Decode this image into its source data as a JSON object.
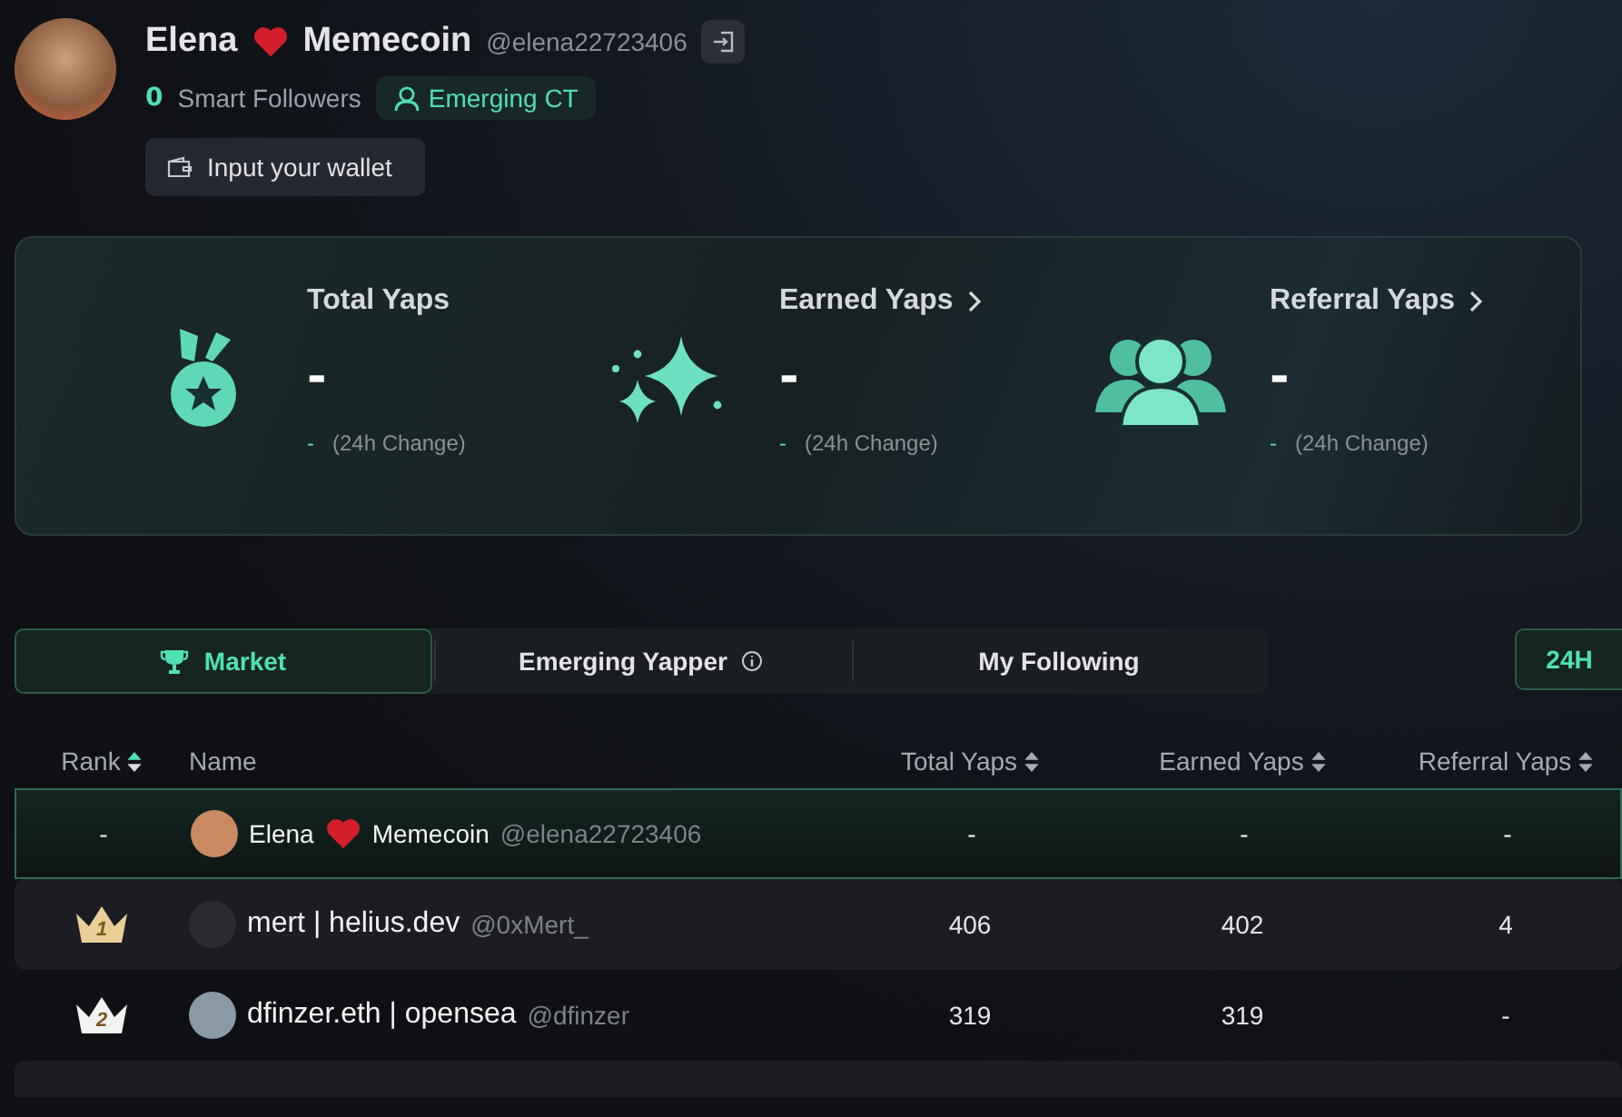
{
  "profile": {
    "name_parts": [
      "Elena",
      "Memecoin"
    ],
    "handle": "@elena22723406",
    "smart_followers_count": "0",
    "smart_followers_label": "Smart Followers",
    "badge": "Emerging CT",
    "wallet_button": "Input your wallet"
  },
  "stats": [
    {
      "kind": "medal",
      "title": "Total Yaps",
      "has_link": false,
      "value": "-",
      "change": "-",
      "change_label": "(24h Change)"
    },
    {
      "kind": "sparkles",
      "title": "Earned Yaps",
      "has_link": true,
      "value": "-",
      "change": "-",
      "change_label": "(24h Change)"
    },
    {
      "kind": "people",
      "title": "Referral Yaps",
      "has_link": true,
      "value": "-",
      "change": "-",
      "change_label": "(24h Change)"
    }
  ],
  "tabs": [
    {
      "label": "Market",
      "selected": true,
      "kind": "trophy"
    },
    {
      "label": "Emerging Yapper",
      "selected": false,
      "kind": "info"
    },
    {
      "label": "My Following",
      "selected": false,
      "kind": "plain"
    }
  ],
  "period_button": "24H",
  "table": {
    "columns": [
      {
        "label": "Rank",
        "sortable": true,
        "sorted": true
      },
      {
        "label": "Name",
        "sortable": false
      },
      {
        "label": "Total Yaps",
        "sortable": true,
        "sorted": false
      },
      {
        "label": "Earned Yaps",
        "sortable": true,
        "sorted": false
      },
      {
        "label": "Referral Yaps",
        "sortable": true,
        "sorted": false
      }
    ],
    "rows": [
      {
        "kind": "self",
        "rank": "-",
        "name_parts": [
          "Elena",
          "Memecoin"
        ],
        "handle": "@elena22723406",
        "total": "-",
        "earned": "-",
        "referral": "-"
      },
      {
        "kind": "ranked",
        "rank": "1",
        "color": "#e9cf97",
        "name_parts": [
          "mert | helius.dev"
        ],
        "handle": "@0xMert_",
        "total": "406",
        "earned": "402",
        "referral": "4"
      },
      {
        "kind": "ranked",
        "rank": "2",
        "color": "#f2f2f2",
        "name_parts": [
          "dfinzer.eth | opensea"
        ],
        "handle": "@dfinzer",
        "total": "319",
        "earned": "319",
        "referral": "-"
      }
    ]
  }
}
